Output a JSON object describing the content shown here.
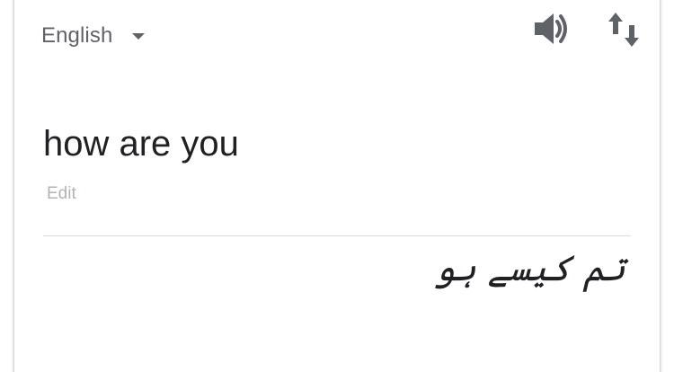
{
  "source": {
    "language": "English",
    "text": "how are you",
    "edit_label": "Edit"
  },
  "target": {
    "text": "تم کیسے ہو"
  },
  "icons": {
    "dropdown": "chevron-down-icon",
    "speak": "speaker-icon",
    "swap": "swap-vertical-icon"
  },
  "colors": {
    "primary_text": "#202124",
    "secondary_text": "#5f6368",
    "muted_text": "#b0b3b8",
    "divider": "#dadce0"
  }
}
